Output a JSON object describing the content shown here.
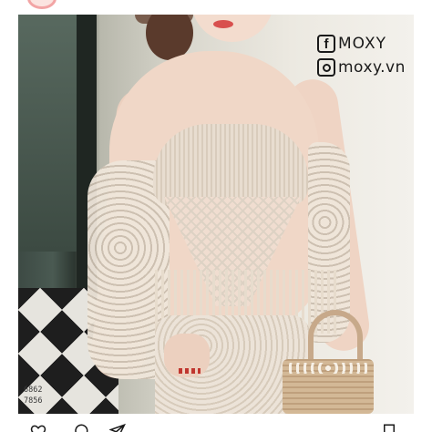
{
  "watermark": {
    "facebook_icon": "facebook-icon",
    "facebook_label": "MOXY",
    "instagram_icon": "instagram-icon",
    "instagram_label": "moxy.vn"
  },
  "photo_code": {
    "line1": "6862",
    "line2": "7856"
  },
  "actions": {
    "like_icon": "heart-icon",
    "comment_icon": "comment-icon",
    "share_icon": "paper-plane-icon",
    "save_icon": "bookmark-icon"
  },
  "colors": {
    "accent_ring": "#f2a5a5",
    "text": "#1a1a1a"
  }
}
